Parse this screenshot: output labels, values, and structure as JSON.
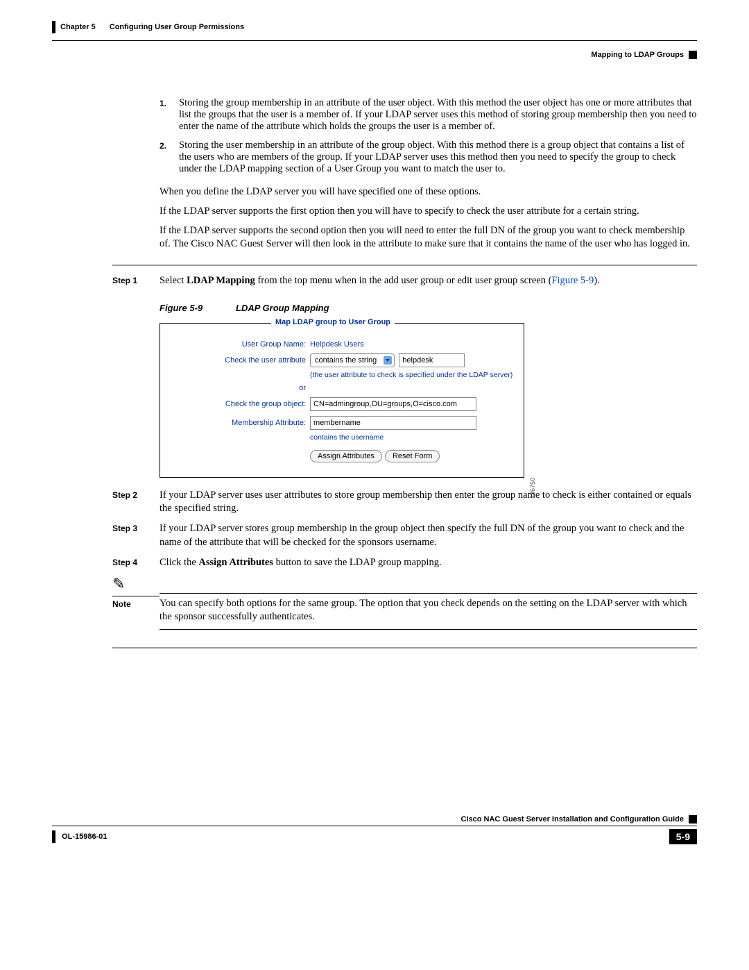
{
  "header": {
    "chapter": "Chapter 5",
    "title": "Configuring User Group Permissions",
    "section": "Mapping to LDAP Groups"
  },
  "list": {
    "item1_num": "1.",
    "item1": "Storing the group membership in an attribute of the user object. With this method the user object has one or more attributes that list the groups that the user is a member of. If your LDAP server uses this method of storing group membership then you need to enter the name of the attribute which holds the groups the user is a member of.",
    "item2_num": "2.",
    "item2": "Storing the user membership in an attribute of the group object. With this method there is a group object that contains a list of the users who are members of the group. If your LDAP server uses this method then you need to specify the group to check under the LDAP mapping section of a User Group you want to match the user to."
  },
  "para1": "When you define the LDAP server you will have specified one of these options.",
  "para2": "If the LDAP server supports the first option then you will have to specify to check the user attribute for a certain string.",
  "para3": "If the LDAP server supports the second option then you will need to enter the full DN of the group you want to check membership of. The Cisco NAC Guest Server will then look in the attribute to make sure that it contains the name of the user who has logged in.",
  "steps": {
    "s1_label": "Step 1",
    "s1_a": "Select ",
    "s1_b": "LDAP Mapping",
    "s1_c": " from the top menu when in the add user group or edit user group screen (",
    "s1_link": "Figure 5-9",
    "s1_d": ").",
    "s2_label": "Step 2",
    "s2": "If your LDAP server uses user attributes to store group membership then enter the group name to check is either contained or equals the specified string.",
    "s3_label": "Step 3",
    "s3": "If your LDAP server stores group membership in the group object then specify the full DN of the group you want to check and the name of the attribute that will be checked for the sponsors username.",
    "s4_label": "Step 4",
    "s4_a": "Click the ",
    "s4_b": "Assign Attributes",
    "s4_c": " button to save the LDAP group mapping."
  },
  "figure": {
    "num": "Figure 5-9",
    "title": "LDAP Group Mapping",
    "legend": "Map LDAP group to User Group",
    "ugn_label": "User Group Name:",
    "ugn_value": "Helpdesk Users",
    "check_user_label": "Check the user attribute",
    "dropdown_value": "contains the string",
    "user_attr_value": "helpdesk",
    "hint": "(the user attribute to check is specified under the LDAP server)",
    "or": "or",
    "check_group_label": "Check the group object:",
    "group_dn": "CN=admingroup,OU=groups,O=cisco.com",
    "mem_attr_label": "Membership Attribute:",
    "mem_attr_value": "membername",
    "contains": "contains the username",
    "btn_assign": "Assign Attributes",
    "btn_reset": "Reset Form",
    "img_id": "186750"
  },
  "note": {
    "label": "Note",
    "text": "You can specify both options for the same group. The option that you check depends on the setting on the LDAP server with which the sponsor successfully authenticates."
  },
  "footer": {
    "guide": "Cisco NAC Guest Server Installation and Configuration Guide",
    "doc": "OL-15986-01",
    "page": "5-9"
  }
}
